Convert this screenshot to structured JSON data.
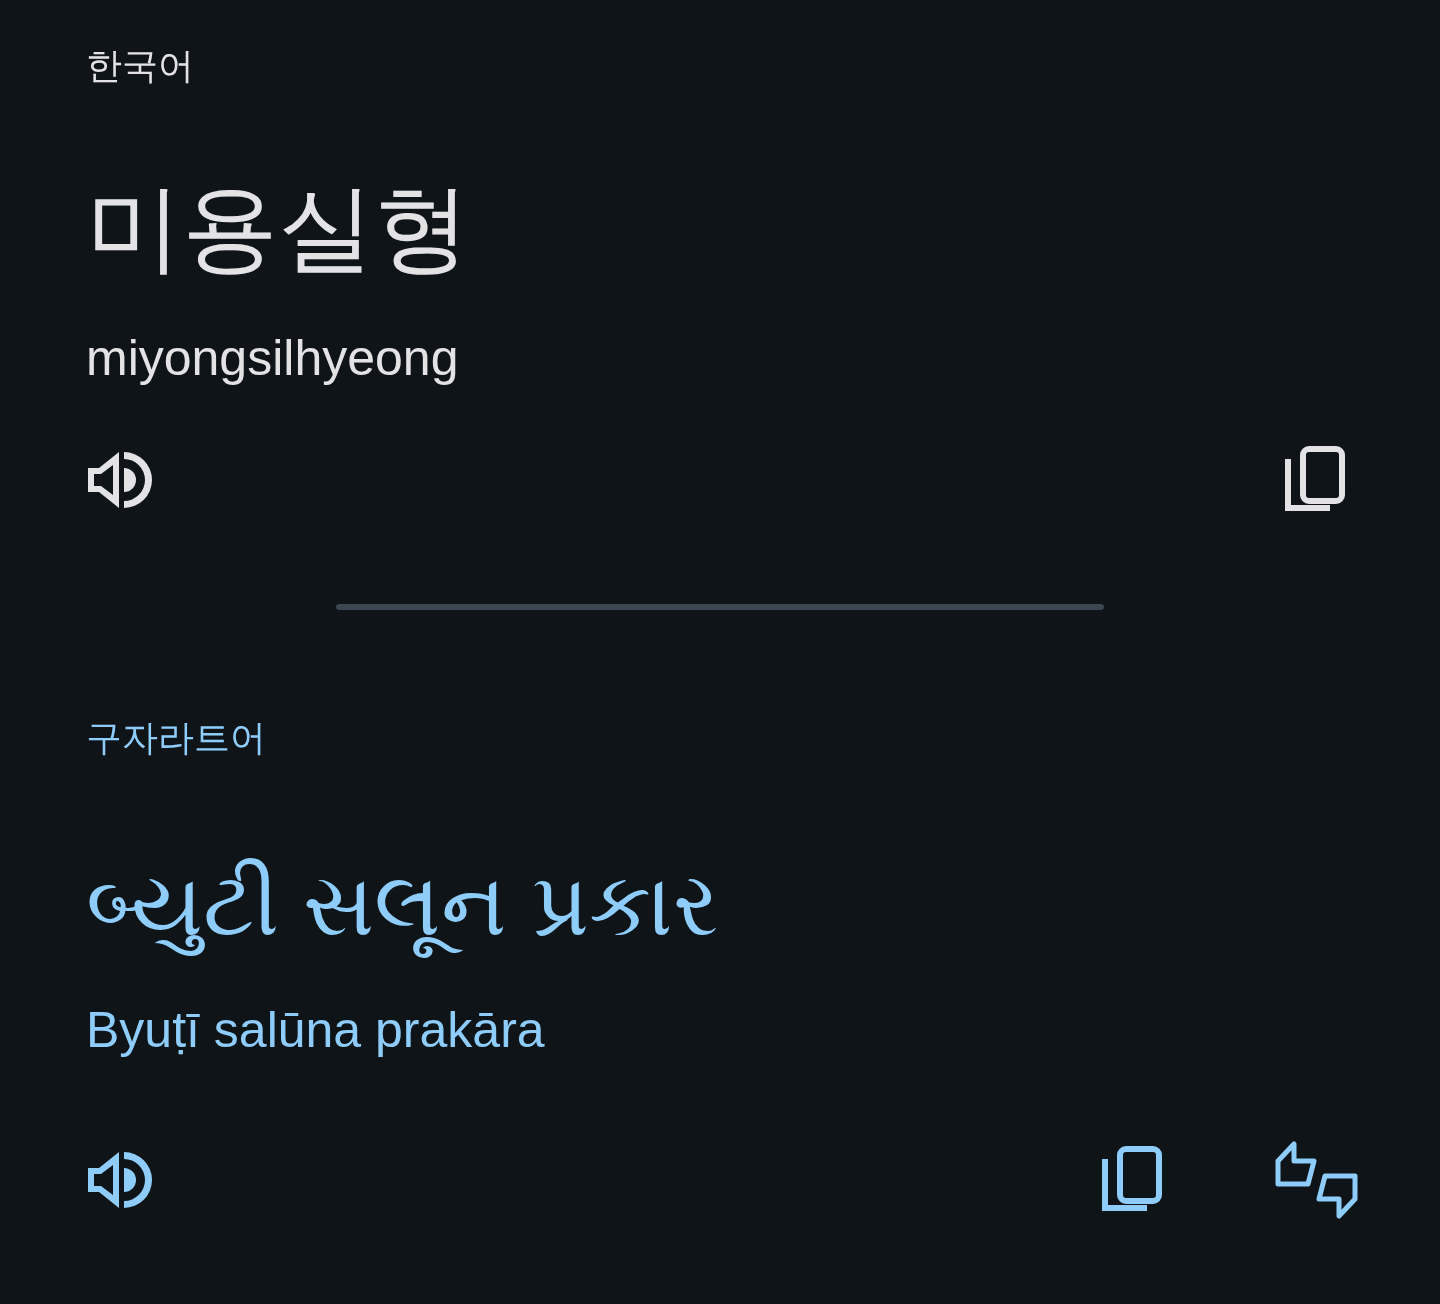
{
  "source": {
    "language": "한국어",
    "text": "미용실형",
    "romanization": "miyongsilhyeong"
  },
  "target": {
    "language": "구자라트어",
    "text": "બ્યુટી સલૂન પ્રકાર",
    "romanization": "Byuṭī salūna prakāra"
  }
}
